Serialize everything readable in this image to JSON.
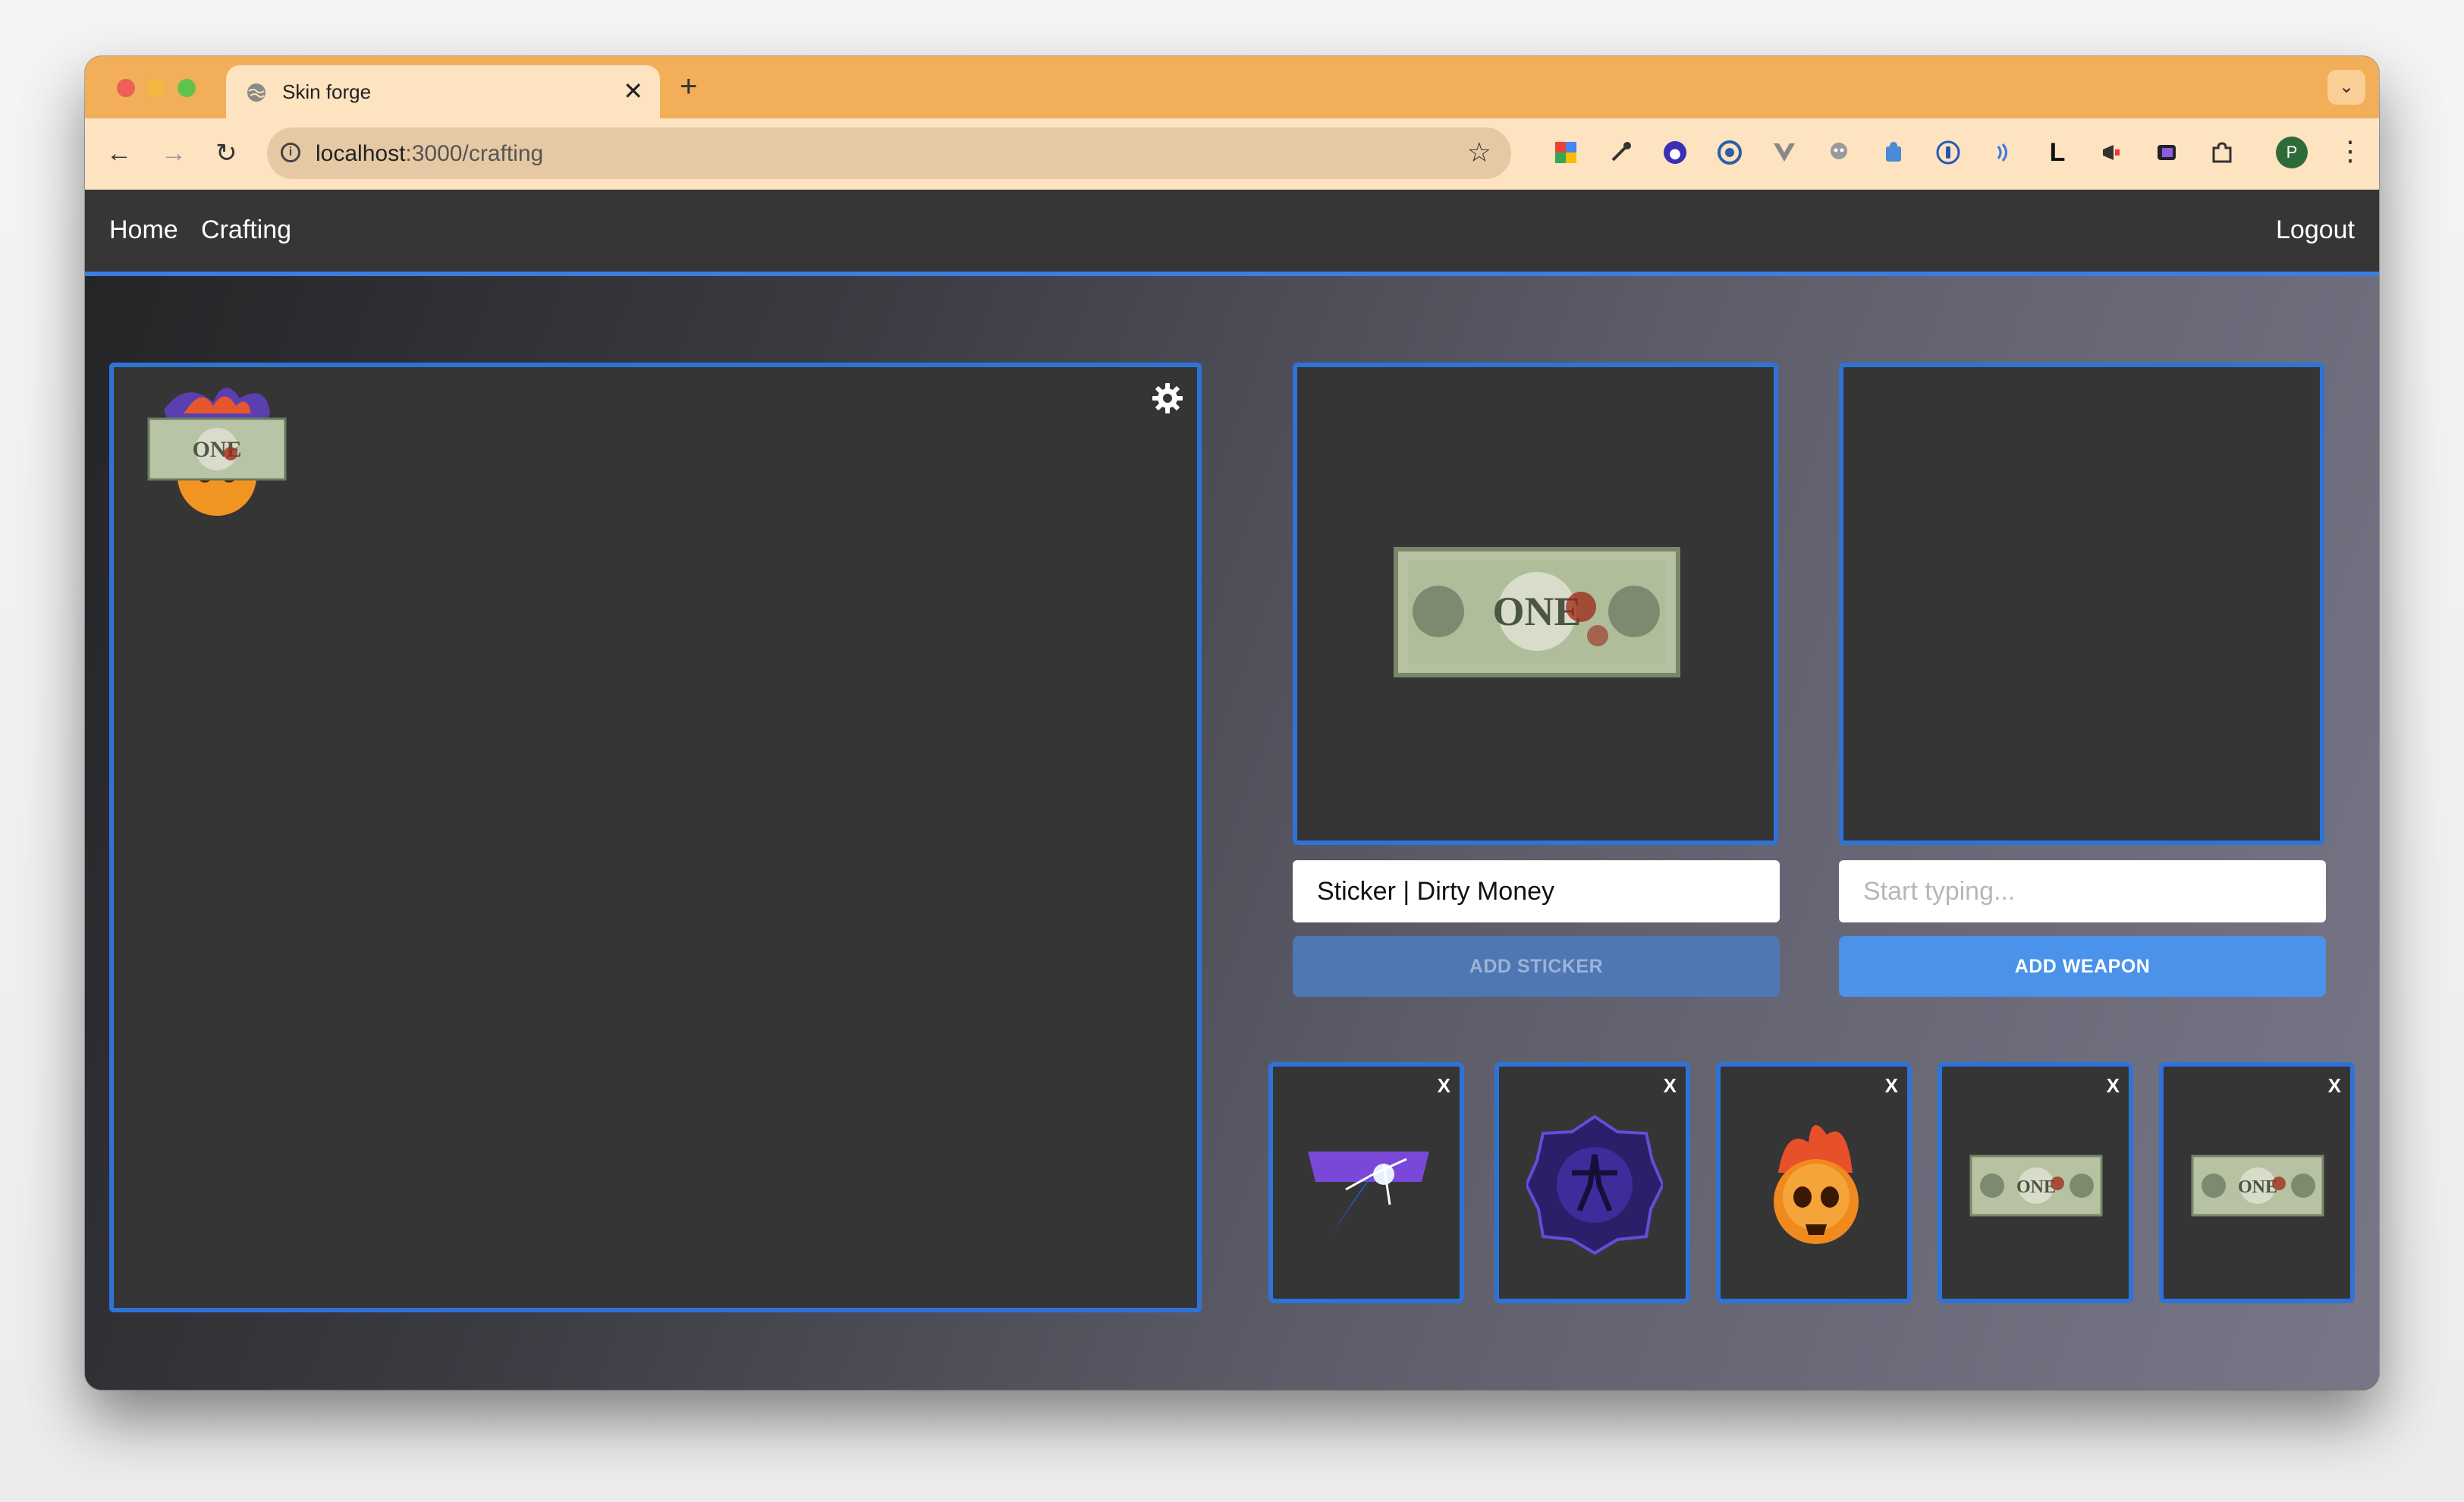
{
  "browser": {
    "tab_title": "Skin forge",
    "tab_close": "✕",
    "new_tab": "+",
    "tab_menu": "⌄",
    "url_host": "localhost",
    "url_path": ":3000/crafting",
    "profile_initial": "P",
    "extensions": [
      "google-icon",
      "eyedropper-icon",
      "extension-icon",
      "extension-icon",
      "vue-icon",
      "ghost-icon",
      "puzzle-icon",
      "password-icon",
      "audio-icon",
      "L",
      "megaphone-icon",
      "color-icon",
      "puzzle-icon"
    ]
  },
  "navbar": {
    "home": "Home",
    "crafting": "Crafting",
    "logout": "Logout"
  },
  "sticker_panel": {
    "selected_value": "Sticker | Dirty Money",
    "add_label": "ADD STICKER"
  },
  "weapon_panel": {
    "placeholder": "Start typing...",
    "add_label": "ADD WEAPON"
  },
  "bill_text": "ONE",
  "saved_stickers": [
    {
      "name": "shattered-web-sticker",
      "remove": "X"
    },
    {
      "name": "csgo-sticker",
      "remove": "X"
    },
    {
      "name": "flaming-skull-sticker",
      "remove": "X"
    },
    {
      "name": "dirty-money-sticker",
      "remove": "X"
    },
    {
      "name": "dirty-money-sticker",
      "remove": "X"
    }
  ],
  "colors": {
    "accent": "#2f73d8",
    "button": "#4a92ea",
    "tabstrip": "#f2ae58",
    "navbar": "#363636"
  }
}
